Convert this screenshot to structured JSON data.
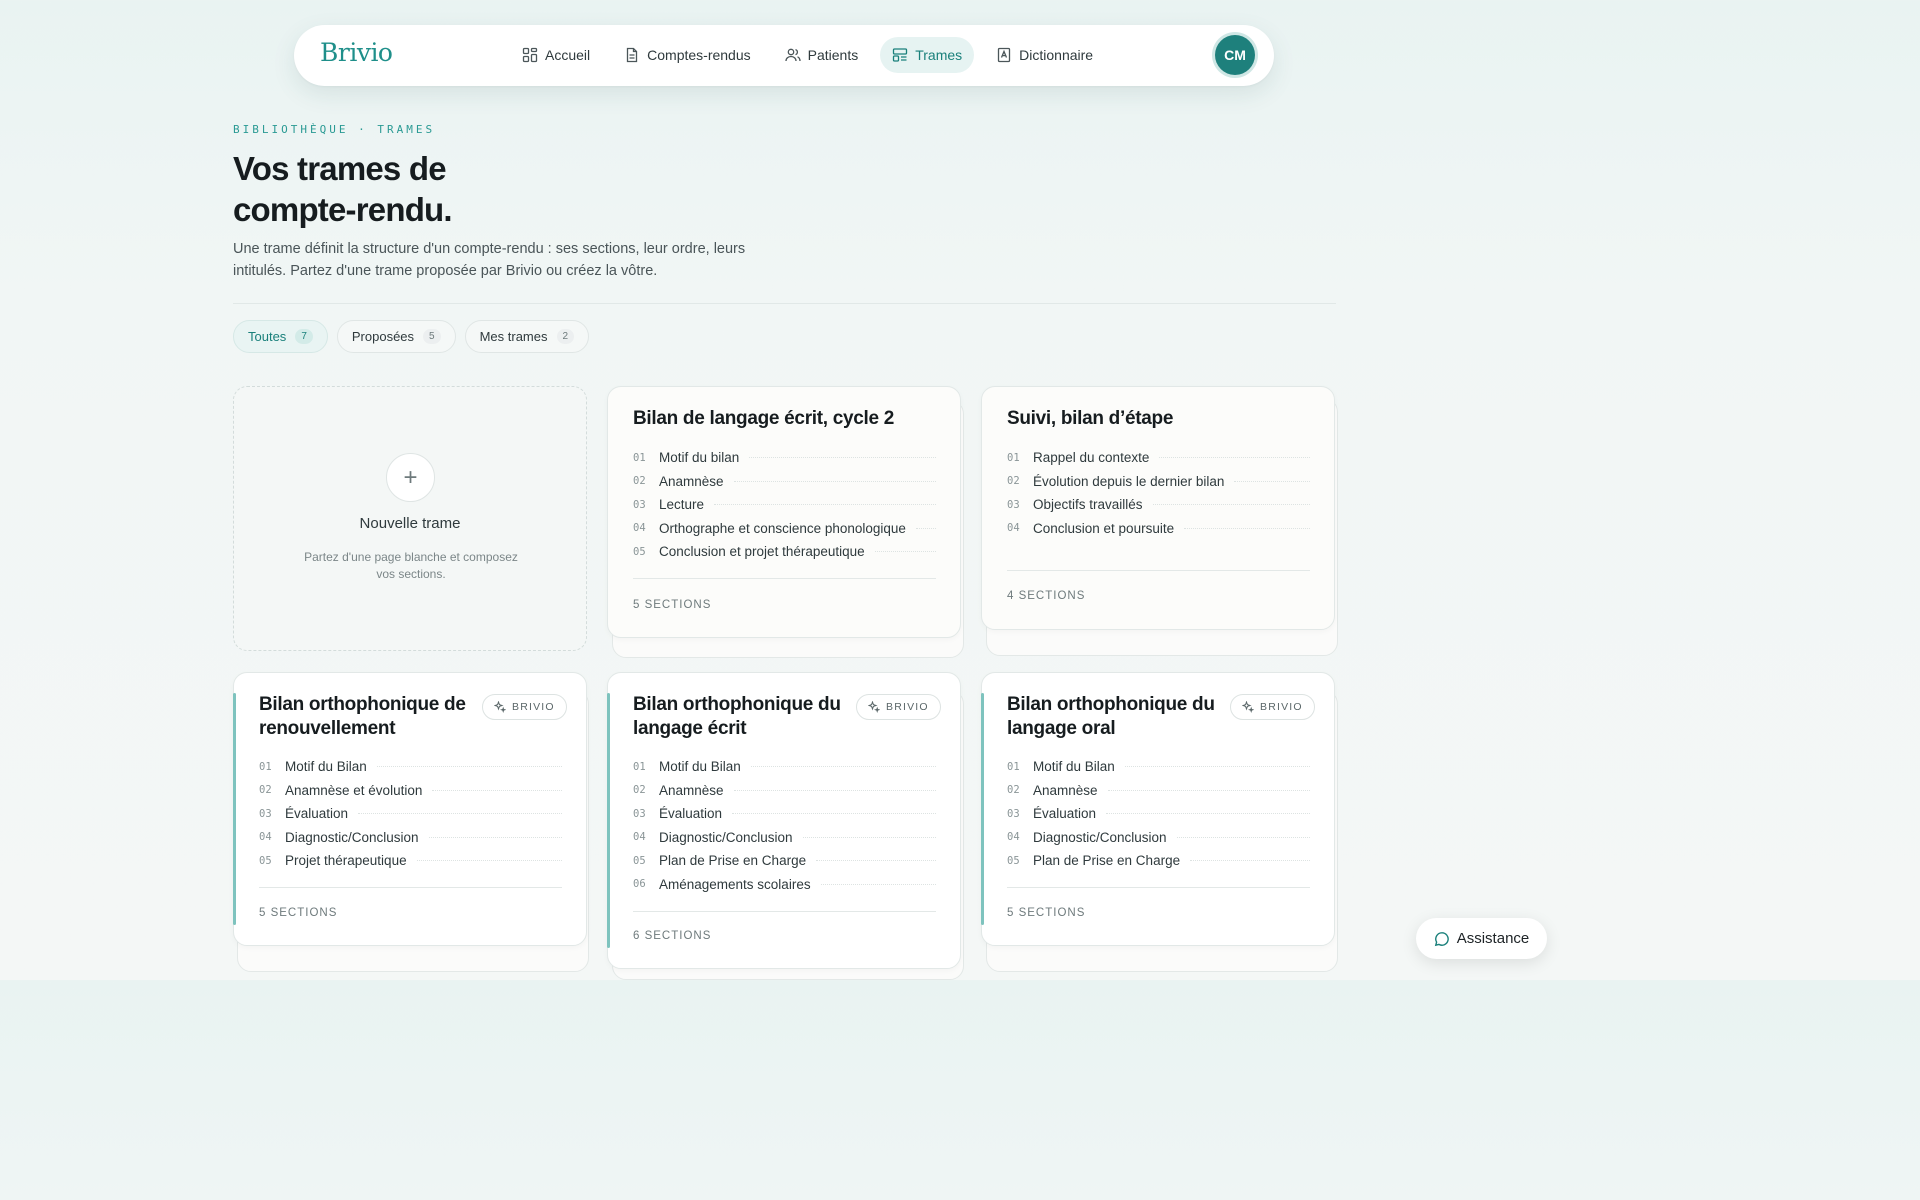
{
  "nav": {
    "logo": "Brivio",
    "items": [
      {
        "label": "Accueil",
        "icon": "grid-icon"
      },
      {
        "label": "Comptes-rendus",
        "icon": "document-icon"
      },
      {
        "label": "Patients",
        "icon": "users-icon"
      },
      {
        "label": "Trames",
        "icon": "template-icon",
        "active": true
      },
      {
        "label": "Dictionnaire",
        "icon": "book-icon"
      }
    ],
    "avatar": "CM"
  },
  "header": {
    "eyebrow": "BIBLIOTHÈQUE · TRAMES",
    "title_line1": "Vos trames de",
    "title_line2": "compte-rendu.",
    "subtitle": "Une trame définit la structure d'un compte-rendu : ses sections, leur ordre, leurs intitulés. Partez d'une trame proposée par Brivio ou créez la vôtre."
  },
  "filters": [
    {
      "label": "Toutes",
      "count": "7",
      "active": true
    },
    {
      "label": "Proposées",
      "count": "5"
    },
    {
      "label": "Mes trames",
      "count": "2"
    }
  ],
  "new_card": {
    "title": "Nouvelle trame",
    "description": "Partez d'une page blanche et composez vos sections."
  },
  "cards": [
    {
      "title": "Bilan de langage écrit, cycle 2",
      "sections": [
        {
          "num": "01",
          "label": "Motif du bilan"
        },
        {
          "num": "02",
          "label": "Anamnèse"
        },
        {
          "num": "03",
          "label": "Lecture"
        },
        {
          "num": "04",
          "label": "Orthographe et conscience phonologique"
        },
        {
          "num": "05",
          "label": "Conclusion et projet thérapeutique"
        }
      ],
      "footer": "5 SECTIONS"
    },
    {
      "title": "Suivi, bilan d’étape",
      "sections": [
        {
          "num": "01",
          "label": "Rappel du contexte"
        },
        {
          "num": "02",
          "label": "Évolution depuis le dernier bilan"
        },
        {
          "num": "03",
          "label": "Objectifs travaillés"
        },
        {
          "num": "04",
          "label": "Conclusion et poursuite"
        }
      ],
      "footer": "4 SECTIONS"
    },
    {
      "title": "Bilan orthophonique de renouvellement",
      "badge": "BRIVIO",
      "sections": [
        {
          "num": "01",
          "label": "Motif du Bilan"
        },
        {
          "num": "02",
          "label": "Anamnèse et évolution"
        },
        {
          "num": "03",
          "label": "Évaluation"
        },
        {
          "num": "04",
          "label": "Diagnostic/Conclusion"
        },
        {
          "num": "05",
          "label": "Projet thérapeutique"
        }
      ],
      "footer": "5 SECTIONS"
    },
    {
      "title": "Bilan orthophonique du langage écrit",
      "badge": "BRIVIO",
      "sections": [
        {
          "num": "01",
          "label": "Motif du Bilan"
        },
        {
          "num": "02",
          "label": "Anamnèse"
        },
        {
          "num": "03",
          "label": "Évaluation"
        },
        {
          "num": "04",
          "label": "Diagnostic/Conclusion"
        },
        {
          "num": "05",
          "label": "Plan de Prise en Charge"
        },
        {
          "num": "06",
          "label": "Aménagements scolaires"
        }
      ],
      "footer": "6 SECTIONS"
    },
    {
      "title": "Bilan orthophonique du langage oral",
      "badge": "BRIVIO",
      "sections": [
        {
          "num": "01",
          "label": "Motif du Bilan"
        },
        {
          "num": "02",
          "label": "Anamnèse"
        },
        {
          "num": "03",
          "label": "Évaluation"
        },
        {
          "num": "04",
          "label": "Diagnostic/Conclusion"
        },
        {
          "num": "05",
          "label": "Plan de Prise en Charge"
        }
      ],
      "footer": "5 SECTIONS"
    }
  ],
  "assistance": {
    "label": "Assistance",
    "icon": "chat-bubble-icon"
  },
  "colors": {
    "accent": "#1f8f8a",
    "accent_soft": "#e6f3f2",
    "card_stripe": "#7ec3be"
  }
}
